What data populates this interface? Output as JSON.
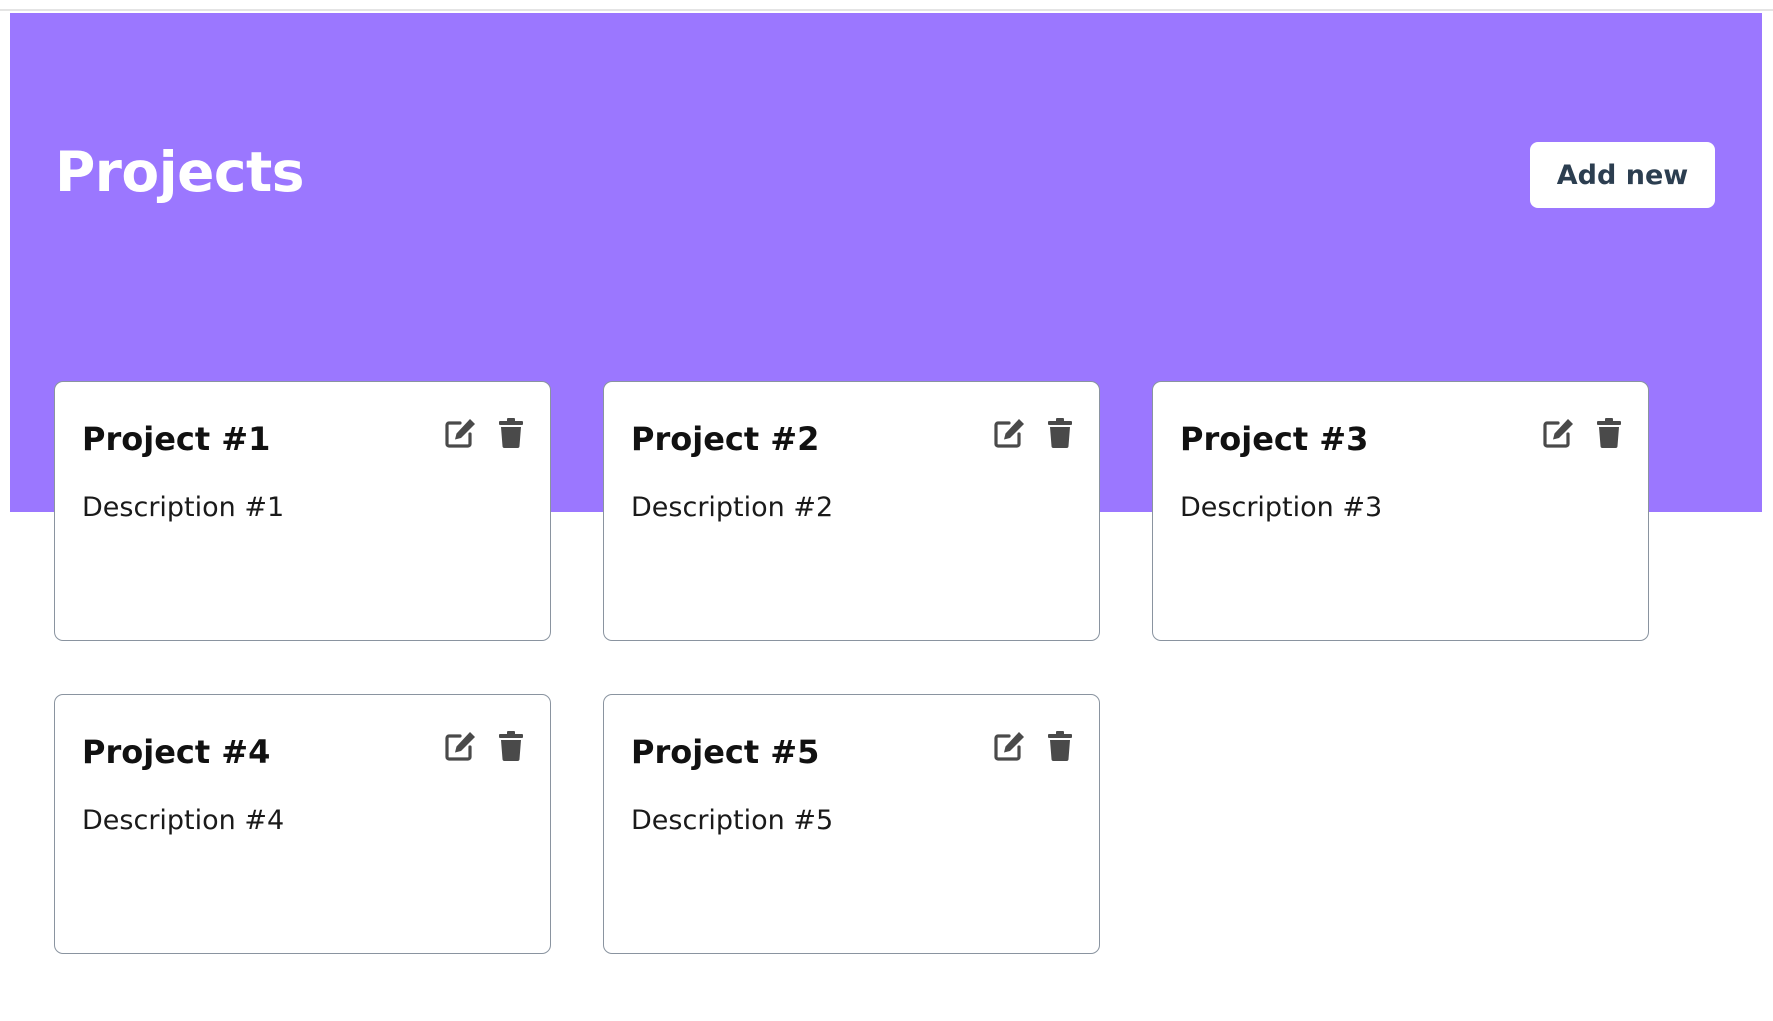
{
  "header": {
    "title": "Projects",
    "add_button_label": "Add new"
  },
  "colors": {
    "hero": "#9b77ff",
    "icon": "#4a4a4a"
  },
  "projects": [
    {
      "title": "Project #1",
      "description": "Description #1",
      "edit_icon": "edit-icon",
      "delete_icon": "trash-icon"
    },
    {
      "title": "Project #2",
      "description": "Description #2",
      "edit_icon": "edit-icon",
      "delete_icon": "trash-icon"
    },
    {
      "title": "Project #3",
      "description": "Description #3",
      "edit_icon": "edit-icon",
      "delete_icon": "trash-icon"
    },
    {
      "title": "Project #4",
      "description": "Description #4",
      "edit_icon": "edit-icon",
      "delete_icon": "trash-icon"
    },
    {
      "title": "Project #5",
      "description": "Description #5",
      "edit_icon": "edit-icon",
      "delete_icon": "trash-icon"
    }
  ]
}
